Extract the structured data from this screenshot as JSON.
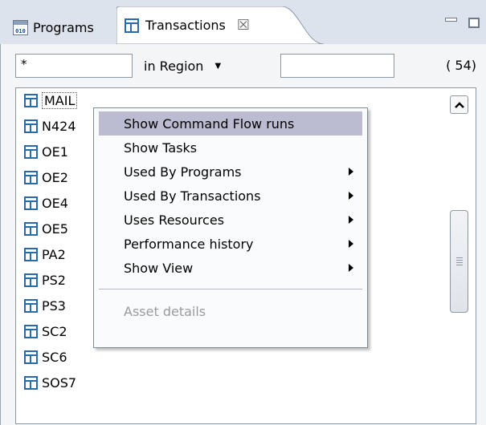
{
  "tabs": [
    {
      "label": "Programs",
      "icon": "program-010-icon",
      "active": false
    },
    {
      "label": "Transactions",
      "icon": "table-icon",
      "active": true,
      "close": "☒"
    }
  ],
  "filter": {
    "name_value": "*",
    "scope_label": "in Region",
    "region_value": "",
    "count": "( 54)"
  },
  "list": {
    "items": [
      "MAIL",
      "N424",
      "OE1",
      "OE2",
      "OE4",
      "OE5",
      "PA2",
      "PS2",
      "PS3",
      "SC2",
      "SC6",
      "SOS7"
    ],
    "selected": "MAIL"
  },
  "context_menu": {
    "items": [
      {
        "label": "Show Command Flow runs",
        "highlighted": true,
        "submenu": false,
        "enabled": true
      },
      {
        "label": "Show Tasks",
        "submenu": false,
        "enabled": true
      },
      {
        "label": "Used By Programs",
        "submenu": true,
        "enabled": true
      },
      {
        "label": "Used By Transactions",
        "submenu": true,
        "enabled": true
      },
      {
        "label": "Uses Resources",
        "submenu": true,
        "enabled": true
      },
      {
        "label": "Performance history",
        "submenu": true,
        "enabled": true
      },
      {
        "label": "Show View",
        "submenu": true,
        "enabled": true
      },
      {
        "label": "Asset details",
        "submenu": false,
        "enabled": false
      }
    ]
  },
  "colors": {
    "tabbar_bg": "#dde3ec",
    "menu_highlight": "#bbbbd2",
    "icon_blue": "#2b6aa8"
  }
}
